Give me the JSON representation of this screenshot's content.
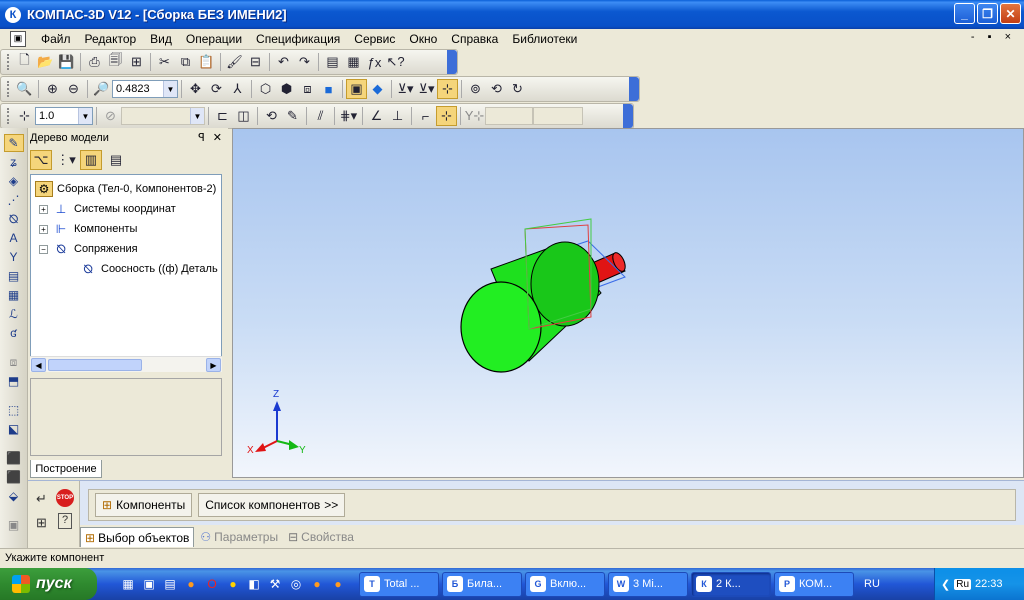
{
  "window": {
    "app_letter": "К",
    "title": "КОМПАС-3D V12 - [Сборка БЕЗ ИМЕНИ2]",
    "min": "_",
    "max": "❐",
    "close": "✕"
  },
  "menu": {
    "items": [
      "Файл",
      "Редактор",
      "Вид",
      "Операции",
      "Спецификация",
      "Сервис",
      "Окно",
      "Справка",
      "Библиотеки"
    ],
    "controls": "- ▪ ×"
  },
  "toolbar_view": {
    "zoom_value": "0.4823"
  },
  "toolbar_grid": {
    "step_value": "1.0"
  },
  "tree": {
    "header": "Дерево модели",
    "pin": "ꟼ",
    "close": "✕",
    "root": "Сборка (Тел-0, Компонентов-2)",
    "items": [
      {
        "label": "Системы координат",
        "expander": "+"
      },
      {
        "label": "Компоненты",
        "expander": "+"
      },
      {
        "label": "Сопряжения",
        "expander": "−"
      }
    ],
    "child": "Соосность ((ф) Деталь",
    "tab": "Построение"
  },
  "axes": {
    "x": "X",
    "y": "Y",
    "z": "Z"
  },
  "properties": {
    "components_label": "Компоненты",
    "list_label": "Список компонентов",
    "list_arrow": ">>",
    "tabs": [
      "Выбор объектов",
      "Параметры",
      "Свойства"
    ],
    "stop": "STOP",
    "help": "?"
  },
  "status": {
    "text": "Укажите компонент"
  },
  "taskbar": {
    "start": "пуск",
    "tasks": [
      {
        "icon": "T",
        "label": "Total ..."
      },
      {
        "icon": "Б",
        "label": "Била..."
      },
      {
        "icon": "G",
        "label": "Вклю..."
      },
      {
        "icon": "W",
        "label": "3 Mi..."
      },
      {
        "icon": "К",
        "label": "2 К..."
      },
      {
        "icon": "P",
        "label": "КОМ..."
      }
    ],
    "lang": "RU",
    "tray_lang": "Ru",
    "clock": "22:33"
  },
  "colors": {
    "cylinder": "#1ee01e",
    "shaft": "#e01414",
    "viewport_top": "#a8c5ef"
  }
}
